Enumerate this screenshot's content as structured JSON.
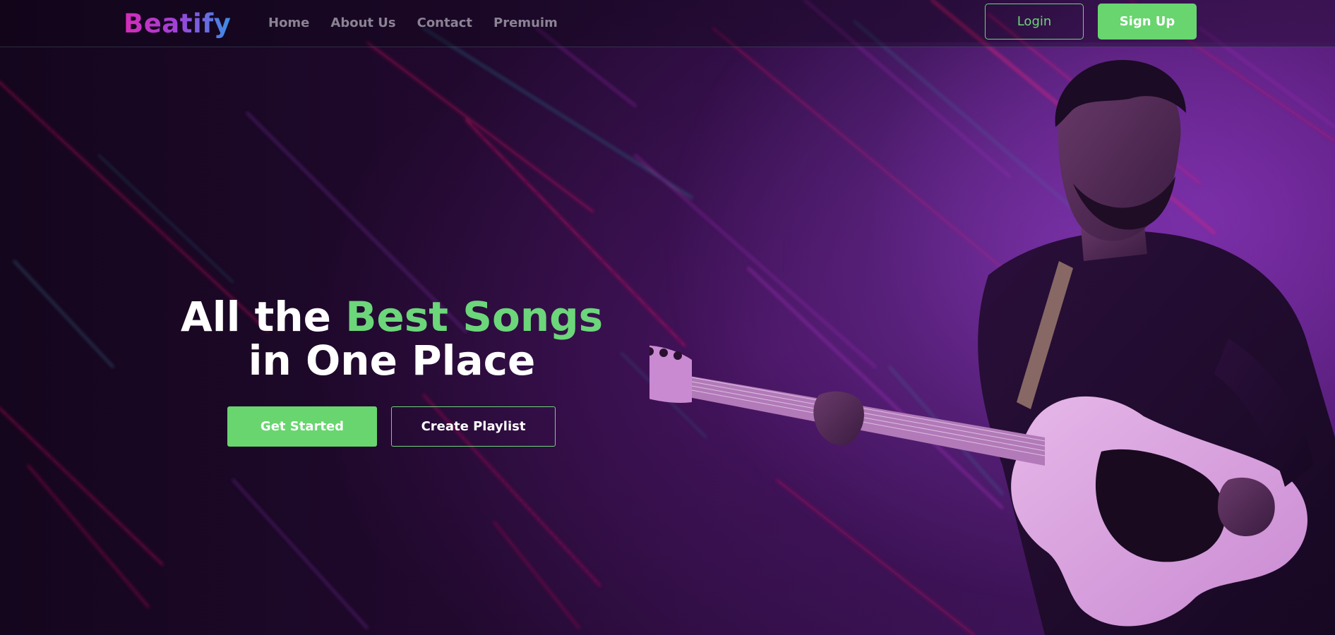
{
  "brand": {
    "name": "Beatify"
  },
  "nav": {
    "links": [
      "Home",
      "About Us",
      "Contact",
      "Premuim"
    ]
  },
  "auth": {
    "login_label": "Login",
    "signup_label": "Sign Up"
  },
  "hero": {
    "title_part1": "All the ",
    "title_accent": "Best Songs",
    "title_line2": "in One Place",
    "get_started_label": "Get Started",
    "create_playlist_label": "Create Playlist"
  },
  "colors": {
    "accent_green": "#68d56f",
    "logo_gradient_start": "#d62bb8",
    "logo_gradient_end": "#3a8fe8",
    "background_dark": "#14061d",
    "background_purple": "#4a1868"
  }
}
